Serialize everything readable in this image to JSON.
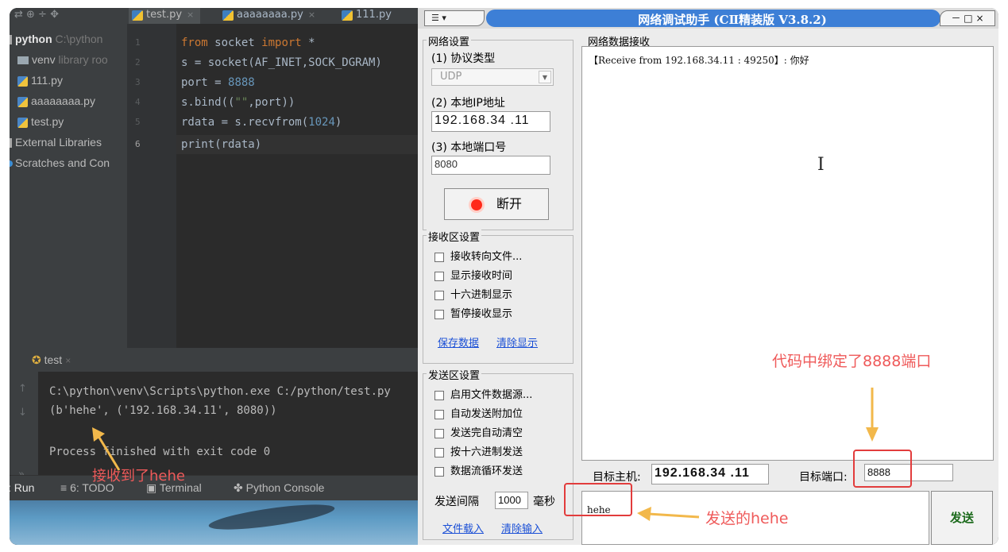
{
  "ide": {
    "tabs": [
      {
        "label": "test.py",
        "active": true
      },
      {
        "label": "aaaaaaaa.py",
        "active": false
      },
      {
        "label": "111.py",
        "active": false
      }
    ],
    "project_tree": {
      "root_name": "python",
      "root_path": "C:\\python",
      "venv_name": "venv",
      "venv_note": "library roo",
      "files": [
        "111.py",
        "aaaaaaaa.py",
        "test.py"
      ],
      "external_libraries": "External Libraries",
      "scratches": "Scratches and Con"
    },
    "line_numbers": [
      "1",
      "2",
      "3",
      "4",
      "5",
      "6"
    ],
    "code_lines": {
      "l1_from": "from",
      "l1_mod": " socket ",
      "l1_import": "import",
      "l1_rest": " *",
      "l2": "s = socket(AF_INET,SOCK_DGRAM)",
      "l3_var": "port = ",
      "l3_num": "8888",
      "l4_a": "s.bind((",
      "l4_str": "\"\"",
      "l4_b": ",port))",
      "l5_a": "rdata = s.recvfrom(",
      "l5_num": "1024",
      "l5_b": ")",
      "l6": "print(rdata)"
    },
    "run": {
      "title": "test",
      "cmd_line": "C:\\python\\venv\\Scripts\\python.exe C:/python/test.py",
      "output_line": "(b'hehe', ('192.168.34.11', 8080))",
      "exit_line": "Process finished with exit code 0",
      "annotation": "接收到了hehe"
    },
    "bottom_bar": {
      "run": "Run",
      "todo": "6: TODO",
      "terminal": "Terminal",
      "python_console": "Python Console"
    }
  },
  "assistant": {
    "title": "网络调试助手 (CⅡ精装版 V3.8.2)",
    "menu_label": "☰ ▾",
    "window_controls": "－ □ ×",
    "net_settings": {
      "group_title": "网络设置",
      "protocol_label": "(1) 协议类型",
      "protocol_value": "UDP",
      "ip_label": "(2) 本地IP地址",
      "ip_value": "192.168.34 .11",
      "port_label": "(3) 本地端口号",
      "port_value": "8080",
      "disconnect_label": "断开"
    },
    "recv_settings": {
      "group_title": "接收区设置",
      "options": [
        "接收转向文件...",
        "显示接收时间",
        "十六进制显示",
        "暂停接收显示"
      ],
      "save_link": "保存数据",
      "clear_link": "清除显示"
    },
    "send_settings": {
      "group_title": "发送区设置",
      "options": [
        "启用文件数据源...",
        "自动发送附加位",
        "发送完自动清空",
        "按十六进制发送",
        "数据流循环发送"
      ],
      "interval_label": "发送间隔",
      "interval_value": "1000",
      "interval_unit": "毫秒",
      "load_file_link": "文件载入",
      "clear_input_link": "清除输入"
    },
    "recv_area": {
      "group_title": "网络数据接收",
      "content": "【Receive from 192.168.34.11 : 49250】: 你好"
    },
    "target": {
      "host_label": "目标主机:",
      "host_value": "192.168.34 .11",
      "port_label": "目标端口:",
      "port_value": "8888"
    },
    "send_area": {
      "content": "hehe",
      "send_button": "发送"
    },
    "annotations": {
      "port_note": "代码中绑定了8888端口",
      "send_note": "发送的hehe"
    }
  }
}
